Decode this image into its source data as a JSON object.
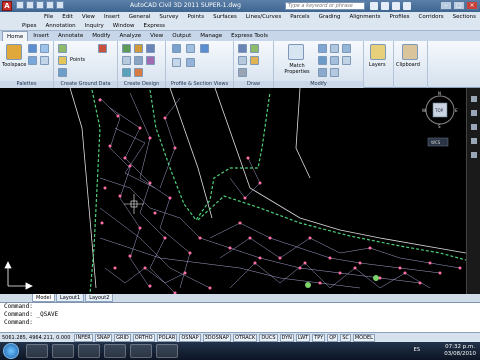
{
  "titlebar": {
    "app_icon": "A",
    "title": "AutoCAD Civil 3D 2011   SUPER-1.dwg",
    "search_placeholder": "Type a keyword or phrase"
  },
  "menu_row1": [
    "File",
    "Edit",
    "View",
    "Insert",
    "General",
    "Survey",
    "Points",
    "Surfaces",
    "Lines/Curves",
    "Parcels",
    "Grading",
    "Alignments",
    "Profiles",
    "Corridors",
    "Sections"
  ],
  "menu_row2": [
    "Pipes",
    "Annotation",
    "Inquiry",
    "Window",
    "Express"
  ],
  "ribbon_tabs": [
    "Home",
    "Insert",
    "Annotate",
    "Modify",
    "Analyze",
    "View",
    "Output",
    "Manage",
    "Express Tools"
  ],
  "ribbon_panels": {
    "palettes": "Palettes",
    "ground_data": "Create Ground Data",
    "design": "Create Design",
    "profile_section": "Profile & Section Views",
    "draw": "Draw",
    "modify": "Modify"
  },
  "ribbon_tools": {
    "toolspace": "Toolspace",
    "points": "Points",
    "match_properties": "Match Properties",
    "layers": "Layers",
    "clipboard": "Clipboard"
  },
  "viewcube": {
    "top": "TOP",
    "n": "N",
    "s": "S",
    "w": "W",
    "e": "E",
    "wcs": "WCS"
  },
  "layout_tabs": [
    "Model",
    "Layout1",
    "Layout2"
  ],
  "command_lines": [
    "Command:",
    "Command:  _QSAVE",
    "Command:"
  ],
  "statusbar": {
    "coords": "5061.285, 4964.211, 0.000",
    "buttons": [
      "INFER",
      "SNAP",
      "GRID",
      "ORTHO",
      "POLAR",
      "OSNAP",
      "3DOSNAP",
      "OTRACK",
      "DUCS",
      "DYN",
      "LWT",
      "TPY",
      "QP",
      "SC",
      "MODEL"
    ]
  },
  "taskbar": {
    "lang": "ES",
    "time": "07:32 p.m.",
    "date": "03/08/2010"
  }
}
